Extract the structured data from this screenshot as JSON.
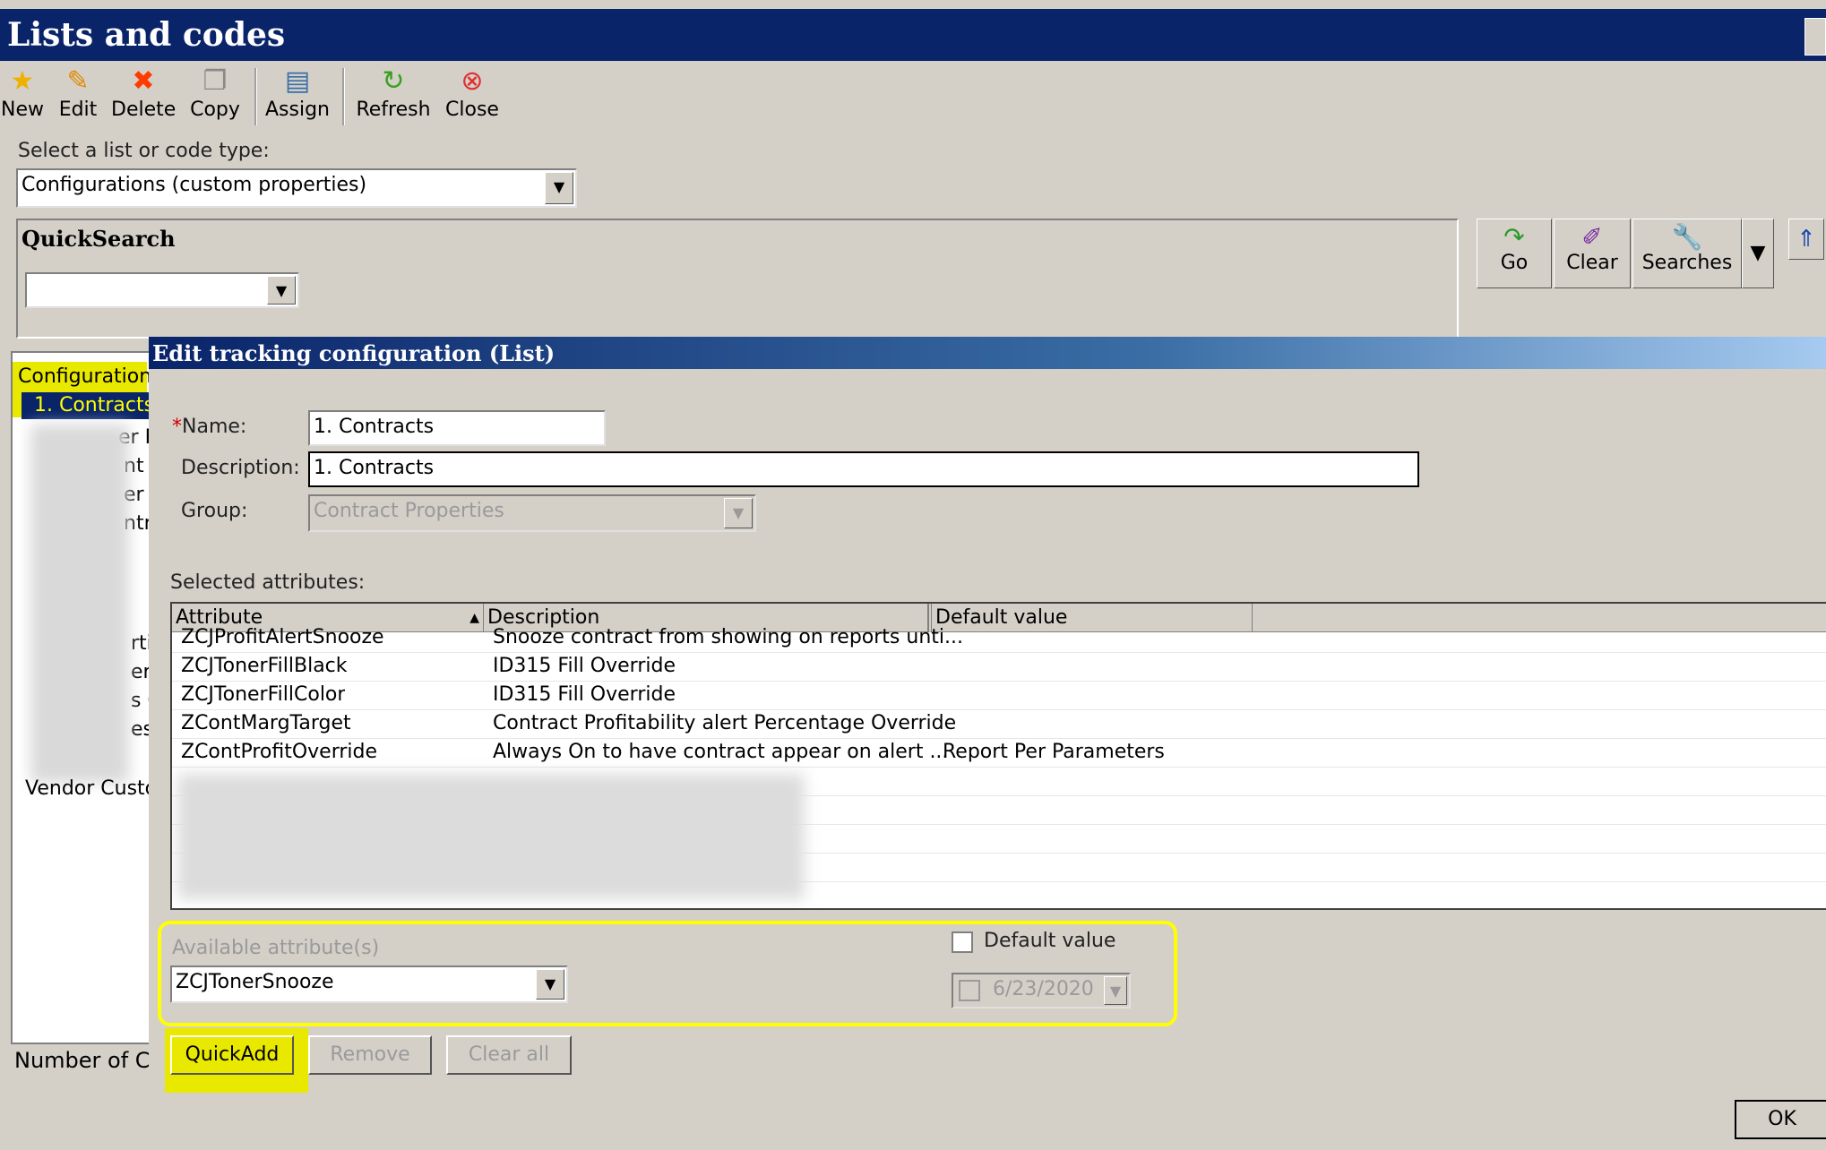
{
  "window": {
    "title": "Lists and codes"
  },
  "toolbar": {
    "new": "New",
    "edit": "Edit",
    "delete": "Delete",
    "copy": "Copy",
    "assign": "Assign",
    "refresh": "Refresh",
    "close": "Close"
  },
  "list_type": {
    "label": "Select a list or code type:",
    "value": "Configurations (custom properties)"
  },
  "quicksearch": {
    "label": "QuickSearch",
    "value": "",
    "go": "Go",
    "clear": "Clear",
    "searches": "Searches"
  },
  "left_panel": {
    "header": "Configuration",
    "selected": "1. Contracts",
    "partial_items": [
      "er F",
      "nt",
      "er C",
      "ntr",
      "rtie",
      "erti",
      "s O",
      "es (",
      "Vendor Custo"
    ],
    "footer": "Number of C"
  },
  "dialog": {
    "title": "Edit tracking configuration (List)",
    "name_label": "*Name:",
    "name_value": "1. Contracts",
    "description_label": "Description:",
    "description_value": "1. Contracts",
    "group_label": "Group:",
    "group_value": "Contract Properties",
    "selected_label": "Selected attributes:",
    "columns": {
      "attribute": "Attribute",
      "description": "Description",
      "default": "Default value"
    },
    "rows": [
      {
        "attribute": "ZCJProfitAlertSnooze",
        "description": "Snooze contract from showing on reports unti...",
        "default": ""
      },
      {
        "attribute": "ZCJTonerFillBlack",
        "description": "ID315 Fill Override",
        "default": ""
      },
      {
        "attribute": "ZCJTonerFillColor",
        "description": "ID315 Fill Override",
        "default": ""
      },
      {
        "attribute": "ZContMargTarget",
        "description": "Contract Profitability alert Percentage Override",
        "default": ""
      },
      {
        "attribute": "ZContProfitOverride",
        "description": "Always On to have contract appear on alert ...",
        "default": "Report Per Parameters"
      }
    ],
    "available_label": "Available attribute(s)",
    "available_value": "ZCJTonerSnooze",
    "default_value_label": "Default value",
    "default_date": "6/23/2020",
    "quickadd": "QuickAdd",
    "remove": "Remove",
    "clear_all": "Clear all",
    "ok": "OK"
  },
  "colors": {
    "titlebar": "#0a246a",
    "highlight": "#ffff00",
    "face": "#d4d0c8"
  }
}
